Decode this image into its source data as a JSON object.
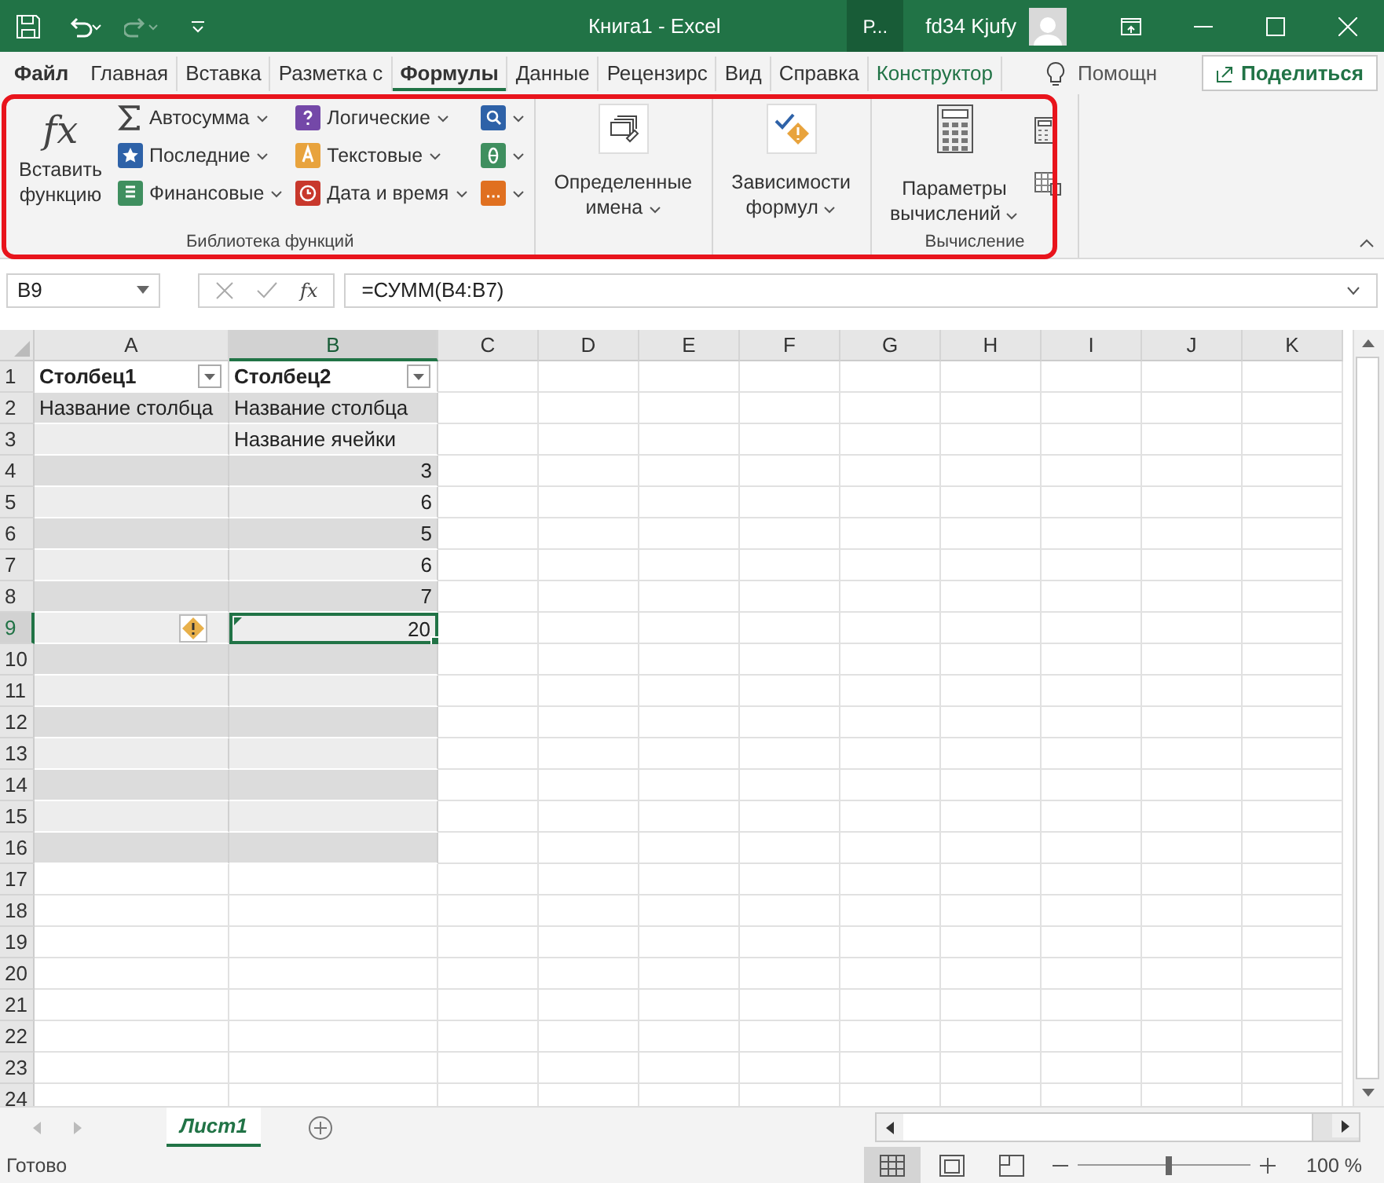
{
  "title_bar": {
    "title": "Книга1  -  Excel",
    "account_button": "Р...",
    "user_name": "fd34 Kjufy"
  },
  "menu_tabs": [
    {
      "label": "Файл",
      "selected": false,
      "kind": "file"
    },
    {
      "label": "Главная",
      "selected": false,
      "kind": "normal"
    },
    {
      "label": "Вставка",
      "selected": false,
      "kind": "normal"
    },
    {
      "label": "Разметка с",
      "selected": false,
      "kind": "normal"
    },
    {
      "label": "Формулы",
      "selected": true,
      "kind": "normal"
    },
    {
      "label": "Данные",
      "selected": false,
      "kind": "normal"
    },
    {
      "label": "Рецензирс",
      "selected": false,
      "kind": "normal"
    },
    {
      "label": "Вид",
      "selected": false,
      "kind": "normal"
    },
    {
      "label": "Справка",
      "selected": false,
      "kind": "normal"
    },
    {
      "label": "Конструктор",
      "selected": false,
      "kind": "contextual"
    }
  ],
  "help_search": "Помощн",
  "share_button": "Поделиться",
  "ribbon": {
    "library": {
      "label": "Библиотека функций",
      "insert_function_glyph": "fx",
      "insert_function": [
        "Вставить",
        "функцию"
      ],
      "columns": [
        [
          {
            "label": "Автосумма",
            "color": "#444444"
          },
          {
            "label": "Последние",
            "color": "#2e62a8"
          },
          {
            "label": "Финансовые",
            "color": "#3f8f5f"
          }
        ],
        [
          {
            "label": "Логические",
            "color": "#7448a8"
          },
          {
            "label": "Текстовые",
            "color": "#e8a33d"
          },
          {
            "label": "Дата и время",
            "color": "#c8382c"
          }
        ],
        [
          {
            "color": "#2e62a8"
          },
          {
            "color": "#3f8f5f"
          },
          {
            "color": "#e07020"
          }
        ]
      ]
    },
    "names": {
      "label": [
        "Определенные",
        "имена"
      ]
    },
    "dependencies": {
      "label": [
        "Зависимости",
        "формул"
      ]
    },
    "calculation": {
      "label": "Вычисление",
      "options": [
        "Параметры",
        "вычислений"
      ]
    }
  },
  "name_box": "B9",
  "formula_glyph": "fx",
  "formula": "=СУММ(B4:B7)",
  "columns": [
    {
      "label": "A",
      "selected": false
    },
    {
      "label": "B",
      "selected": true
    },
    {
      "label": "C",
      "selected": false
    },
    {
      "label": "D",
      "selected": false
    },
    {
      "label": "E",
      "selected": false
    },
    {
      "label": "F",
      "selected": false
    },
    {
      "label": "G",
      "selected": false
    },
    {
      "label": "H",
      "selected": false
    },
    {
      "label": "I",
      "selected": false
    },
    {
      "label": "J",
      "selected": false
    },
    {
      "label": "K",
      "selected": false
    }
  ],
  "rows": [
    {
      "number": "1",
      "selected": false,
      "kind": "header",
      "cells": [
        {
          "text": "Столбец1",
          "kind": "header"
        },
        {
          "text": "Столбец2",
          "kind": "header"
        }
      ]
    },
    {
      "number": "2",
      "selected": false,
      "kind": "data",
      "cells": [
        {
          "text": "Название столбца",
          "kind": "text"
        },
        {
          "text": "Название столбца",
          "kind": "text"
        }
      ]
    },
    {
      "number": "3",
      "selected": false,
      "kind": "data",
      "cells": [
        {
          "kind": "empty"
        },
        {
          "text": "Название ячейки",
          "kind": "text"
        }
      ]
    },
    {
      "number": "4",
      "selected": false,
      "kind": "data",
      "cells": [
        {
          "kind": "empty"
        },
        {
          "text": "3",
          "kind": "number"
        }
      ]
    },
    {
      "number": "5",
      "selected": false,
      "kind": "data",
      "cells": [
        {
          "kind": "empty"
        },
        {
          "text": "6",
          "kind": "number"
        }
      ]
    },
    {
      "number": "6",
      "selected": false,
      "kind": "data",
      "cells": [
        {
          "kind": "empty"
        },
        {
          "text": "5",
          "kind": "number"
        }
      ]
    },
    {
      "number": "7",
      "selected": false,
      "kind": "data",
      "cells": [
        {
          "kind": "empty"
        },
        {
          "text": "6",
          "kind": "number"
        }
      ]
    },
    {
      "number": "8",
      "selected": false,
      "kind": "data",
      "cells": [
        {
          "kind": "empty"
        },
        {
          "text": "7",
          "kind": "number"
        }
      ]
    },
    {
      "number": "9",
      "selected": true,
      "kind": "data",
      "cells": [
        {
          "kind": "warning"
        },
        {
          "text": "20",
          "kind": "number",
          "selected": true
        }
      ]
    },
    {
      "number": "10",
      "selected": false,
      "kind": "data",
      "cells": [
        {
          "kind": "empty"
        },
        {
          "kind": "empty"
        }
      ]
    },
    {
      "number": "11",
      "selected": false,
      "kind": "data",
      "cells": [
        {
          "kind": "empty"
        },
        {
          "kind": "empty"
        }
      ]
    },
    {
      "number": "12",
      "selected": false,
      "kind": "data",
      "cells": [
        {
          "kind": "empty"
        },
        {
          "kind": "empty"
        }
      ]
    },
    {
      "number": "13",
      "selected": false,
      "kind": "data",
      "cells": [
        {
          "kind": "empty"
        },
        {
          "kind": "empty"
        }
      ]
    },
    {
      "number": "14",
      "selected": false,
      "kind": "data",
      "cells": [
        {
          "kind": "empty"
        },
        {
          "kind": "empty"
        }
      ]
    },
    {
      "number": "15",
      "selected": false,
      "kind": "data",
      "cells": [
        {
          "kind": "empty"
        },
        {
          "kind": "empty"
        }
      ]
    },
    {
      "number": "16",
      "selected": false,
      "kind": "data",
      "cells": [
        {
          "kind": "empty"
        },
        {
          "kind": "empty"
        }
      ]
    },
    {
      "number": "17",
      "selected": false,
      "kind": "blank",
      "cells": []
    },
    {
      "number": "18",
      "selected": false,
      "kind": "blank",
      "cells": []
    },
    {
      "number": "19",
      "selected": false,
      "kind": "blank",
      "cells": []
    },
    {
      "number": "20",
      "selected": false,
      "kind": "blank",
      "cells": []
    },
    {
      "number": "21",
      "selected": false,
      "kind": "blank",
      "cells": []
    },
    {
      "number": "22",
      "selected": false,
      "kind": "blank",
      "cells": []
    },
    {
      "number": "23",
      "selected": false,
      "kind": "blank",
      "cells": []
    },
    {
      "number": "24",
      "selected": false,
      "kind": "blank",
      "cells": []
    }
  ],
  "sheet_tabs": [
    {
      "label": "Лист1",
      "selected": true
    }
  ],
  "status": "Готово",
  "zoom": {
    "level": 0.53,
    "reading": "100 %"
  }
}
